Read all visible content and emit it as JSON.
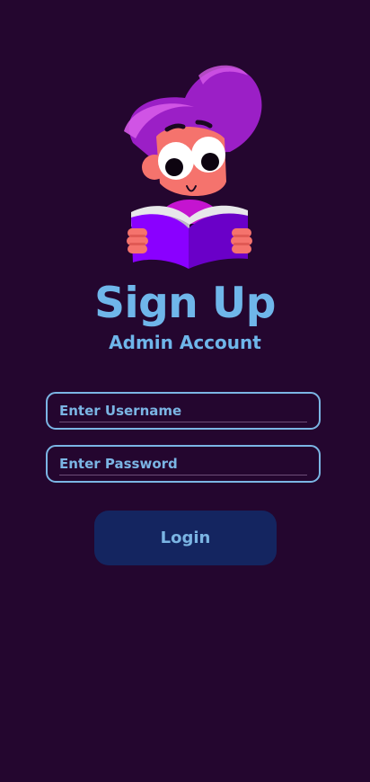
{
  "header": {
    "title": "Sign Up",
    "subtitle": "Admin Account"
  },
  "illustration": {
    "icon": "reading-character-illustration"
  },
  "form": {
    "username_placeholder": "Enter Username",
    "username_value": "",
    "password_placeholder": "Enter Password",
    "password_value": "",
    "login_label": "Login"
  },
  "colors": {
    "background": "#24062f",
    "accent": "#6fb6ea",
    "button_bg": "#142560",
    "hair": "#9b1fc6",
    "book": "#8a00ff"
  }
}
